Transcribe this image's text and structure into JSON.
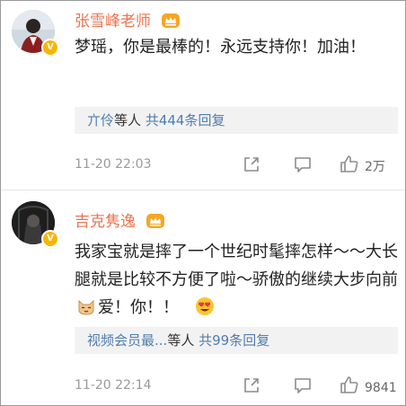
{
  "comments": [
    {
      "name": "张雪峰老师",
      "text": "梦瑶，你是最棒的！永远支持你！加油！",
      "reply_names": "亣伶",
      "reply_mid": "等人",
      "reply_count": "共444条回复",
      "time": "11-20 22:03",
      "likes": "2万"
    },
    {
      "name": "吉克隽逸",
      "text_part1": "我家宝就是摔了一个世纪时髦摔怎样～～大长腿就是比较不方便了啦～骄傲的继续大步向前",
      "text_part2": "爱！你！！",
      "reply_names": "视频会员最...",
      "reply_mid": "等人",
      "reply_count": "共99条回复",
      "time": "11-20 22:14",
      "likes": "9841"
    }
  ],
  "icons": {
    "verified": "verified-v-badge",
    "crown": "crown-badge-icon",
    "share": "share-icon",
    "comment": "comment-icon",
    "like": "thumbs-up-icon",
    "cat": "cat-face-emoji",
    "heart_eyes": "heart-eyes-emoji"
  },
  "colors": {
    "name": "#eb7350",
    "link": "#507daf",
    "meta": "#999999",
    "reply_bg": "#f2f2f2"
  }
}
